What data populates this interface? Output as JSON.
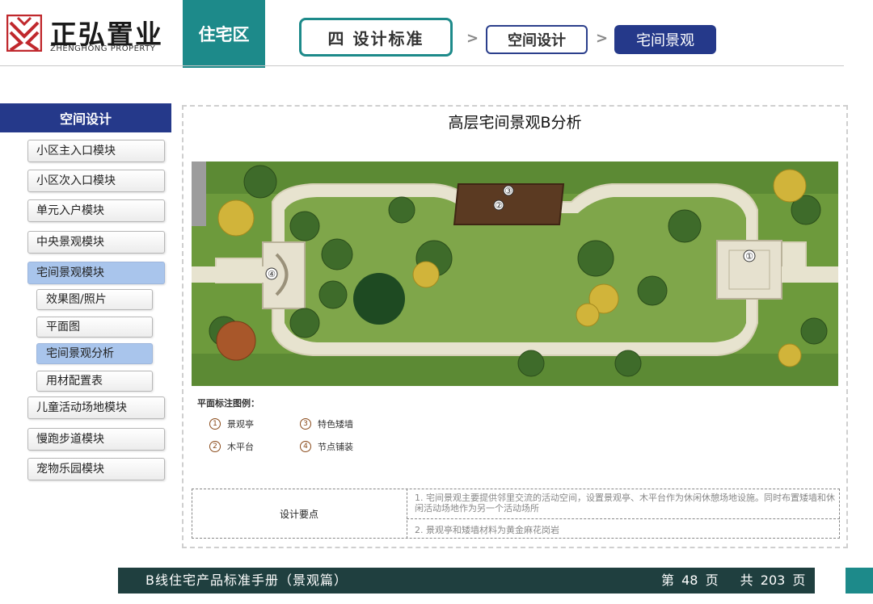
{
  "header": {
    "logo_cn": "正弘置业",
    "logo_en": "ZHENGHONG PROPERTY",
    "zone": "住宅区",
    "breadcrumb": [
      "四   设计标准",
      "空间设计",
      "宅间景观"
    ]
  },
  "sidebar": {
    "heading": "空间设计",
    "items": [
      {
        "label": "小区主入口模块"
      },
      {
        "label": "小区次入口模块"
      },
      {
        "label": "单元入户模块"
      },
      {
        "label": "中央景观模块"
      },
      {
        "label": "宅间景观模块",
        "active": true
      },
      {
        "label": "儿童活动场地模块"
      },
      {
        "label": "慢跑步道模块"
      },
      {
        "label": "宠物乐园模块"
      }
    ],
    "subitems": [
      {
        "label": "效果图/照片"
      },
      {
        "label": "平面图"
      },
      {
        "label": "宅间景观分析",
        "active": true
      },
      {
        "label": "用材配置表"
      }
    ]
  },
  "main": {
    "title": "高层宅间景观B分析",
    "plan_markers": [
      "①",
      "②",
      "③",
      "④"
    ],
    "legend_title": "平面标注图例：",
    "legend": [
      {
        "num": "1",
        "label": "景观亭"
      },
      {
        "num": "3",
        "label": "特色矮墙"
      },
      {
        "num": "2",
        "label": "木平台"
      },
      {
        "num": "4",
        "label": "节点铺装"
      }
    ],
    "design_table": {
      "label": "设计要点",
      "row1": "1. 宅间景观主要提供邻里交流的活动空间，设置景观亭、木平台作为休闲休憩场地设施。同时布置矮墙和休闲活动场地作为另一个活动场所",
      "row2": "2. 景观亭和矮墙材料为黄金麻花岗岩"
    }
  },
  "footer": {
    "title": "B线住宅产品标准手册（景观篇）",
    "page_prefix": "第",
    "page": "48",
    "page_suffix": "页",
    "total_prefix": "共",
    "total": "203",
    "total_suffix": "页"
  },
  "colors": {
    "teal": "#1d8a8a",
    "navy": "#25398a",
    "footer": "#1f3f3f",
    "active_item": "#a9c5ec",
    "grass": "#6d9a3c",
    "wood_deck": "#5b3a22"
  }
}
